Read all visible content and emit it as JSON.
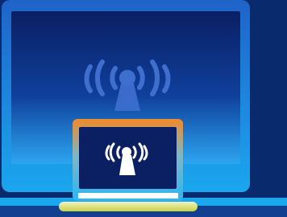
{
  "scene": {
    "icons": {
      "large_broadcast": "broadcast-tower-icon",
      "small_broadcast": "broadcast-tower-icon"
    },
    "colors": {
      "page_background": "#0a2a6e",
      "monitor_bezel_top": "#1f63c9",
      "monitor_bezel_bottom": "#1aa7ee",
      "monitor_screen": "#0b1f63",
      "monitor_screen_bottom": "#2ca5f0",
      "large_icon": "#3e6fcf",
      "laptop_frame_top": "#f08a2a",
      "laptop_frame_bottom": "#2bb6f3",
      "laptop_screen": "#0b1f63",
      "laptop_icon": "#ffffff",
      "laptop_base": "#f2f0c8",
      "laptop_base_shadow": "#c8d33d",
      "laptop_keyboard_strip": "#ffffff"
    }
  }
}
